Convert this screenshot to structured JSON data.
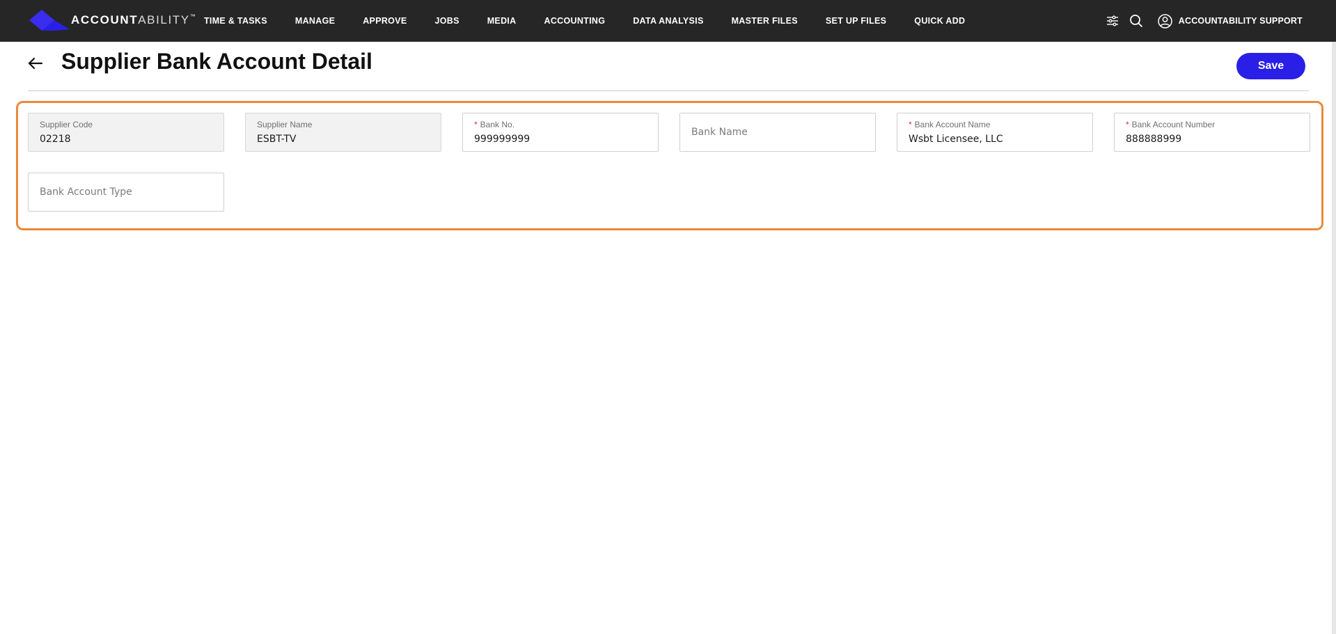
{
  "app": {
    "logo_bold": "ACCOUNT",
    "logo_light": "ABILITY",
    "logo_tm": "™",
    "brand_color": "#2a1fe6"
  },
  "nav": {
    "items": [
      {
        "label": "TIME & TASKS"
      },
      {
        "label": "MANAGE"
      },
      {
        "label": "APPROVE"
      },
      {
        "label": "JOBS"
      },
      {
        "label": "MEDIA"
      },
      {
        "label": "ACCOUNTING"
      },
      {
        "label": "DATA ANALYSIS"
      },
      {
        "label": "MASTER FILES"
      },
      {
        "label": "SET UP FILES"
      },
      {
        "label": "QUICK ADD"
      }
    ]
  },
  "toolbar": {
    "filter_icon": "sliders-icon",
    "search_icon": "search-icon",
    "user_icon": "user-circle-icon",
    "user_name": "ACCOUNTABILITY SUPPORT"
  },
  "page": {
    "title": "Supplier Bank Account Detail",
    "back_icon": "arrow-left-icon",
    "save_label": "Save"
  },
  "form": {
    "highlight_color": "#e98a3a",
    "required_color": "#d32f2f",
    "supplier_code": {
      "label": "Supplier Code",
      "value": "02218",
      "readonly": true
    },
    "supplier_name": {
      "label": "Supplier Name",
      "value": "ESBT-TV",
      "readonly": true
    },
    "bank_no": {
      "label": "Bank No.",
      "value": "999999999",
      "required": true
    },
    "bank_name": {
      "placeholder": "Bank Name",
      "value": ""
    },
    "bank_account_name": {
      "label": "Bank Account Name",
      "value": "Wsbt Licensee, LLC",
      "required": true
    },
    "bank_account_number": {
      "label": "Bank Account Number",
      "value": "888888999",
      "required": true
    },
    "bank_account_type": {
      "placeholder": "Bank Account Type",
      "value": ""
    },
    "required_marker": "*"
  }
}
